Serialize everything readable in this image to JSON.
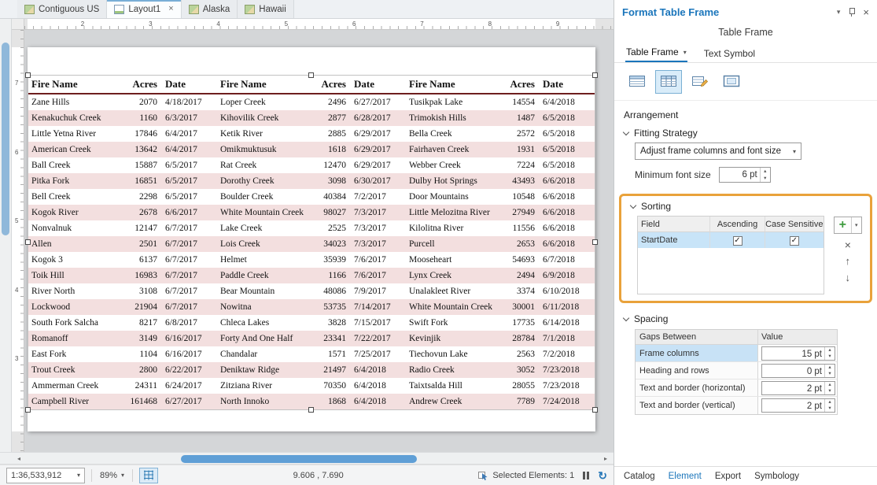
{
  "colors": {
    "accent_blue": "#1a75bb",
    "highlight_orange": "#e9a23b",
    "selection_blue": "#c8e4f8",
    "row_stripe_pink": "#f3dfdf",
    "table_header_line": "#6e1e1e"
  },
  "doc_tabs": [
    {
      "label": "Contiguous US",
      "icon": "map-icon",
      "active": false,
      "closable": false
    },
    {
      "label": "Layout1",
      "icon": "layout-icon",
      "active": true,
      "closable": true
    },
    {
      "label": "Alaska",
      "icon": "map-icon",
      "active": false,
      "closable": false
    },
    {
      "label": "Hawaii",
      "icon": "map-icon",
      "active": false,
      "closable": false
    }
  ],
  "rulers": {
    "horizontal_numbers": [
      "2",
      "3",
      "4",
      "5",
      "6",
      "7",
      "8",
      "9"
    ],
    "vertical_numbers": [
      "7",
      "6",
      "5",
      "4",
      "3"
    ]
  },
  "fire_table": {
    "headers": [
      "Fire Name",
      "Acres",
      "Date"
    ],
    "groups": [
      {
        "rows": [
          [
            "Zane Hills",
            "2070",
            "4/18/2017"
          ],
          [
            "Kenakuchuk Creek",
            "1160",
            "6/3/2017"
          ],
          [
            "Little Yetna River",
            "17846",
            "6/4/2017"
          ],
          [
            "American Creek",
            "13642",
            "6/4/2017"
          ],
          [
            "Ball Creek",
            "15887",
            "6/5/2017"
          ],
          [
            "Pitka Fork",
            "16851",
            "6/5/2017"
          ],
          [
            "Bell Creek",
            "2298",
            "6/5/2017"
          ],
          [
            "Kogok River",
            "2678",
            "6/6/2017"
          ],
          [
            "Nonvalnuk",
            "12147",
            "6/7/2017"
          ],
          [
            "Allen",
            "2501",
            "6/7/2017"
          ],
          [
            "Kogok 3",
            "6137",
            "6/7/2017"
          ],
          [
            "Toik Hill",
            "16983",
            "6/7/2017"
          ],
          [
            "River North",
            "3108",
            "6/7/2017"
          ],
          [
            "Lockwood",
            "21904",
            "6/7/2017"
          ],
          [
            "South Fork Salcha",
            "8217",
            "6/8/2017"
          ],
          [
            "Romanoff",
            "3149",
            "6/16/2017"
          ],
          [
            "East Fork",
            "1104",
            "6/16/2017"
          ],
          [
            "Trout Creek",
            "2800",
            "6/22/2017"
          ],
          [
            "Ammerman Creek",
            "24311",
            "6/24/2017"
          ],
          [
            "Campbell River",
            "161468",
            "6/27/2017"
          ]
        ]
      },
      {
        "rows": [
          [
            "Loper Creek",
            "2496",
            "6/27/2017"
          ],
          [
            "Kihovilik Creek",
            "2877",
            "6/28/2017"
          ],
          [
            "Ketik River",
            "2885",
            "6/29/2017"
          ],
          [
            "Omikmuktusuk",
            "1618",
            "6/29/2017"
          ],
          [
            "Rat Creek",
            "12470",
            "6/29/2017"
          ],
          [
            "Dorothy Creek",
            "3098",
            "6/30/2017"
          ],
          [
            "Boulder Creek",
            "40384",
            "7/2/2017"
          ],
          [
            "White Mountain Creek",
            "98027",
            "7/3/2017"
          ],
          [
            "Lake Creek",
            "2525",
            "7/3/2017"
          ],
          [
            "Lois Creek",
            "34023",
            "7/3/2017"
          ],
          [
            "Helmet",
            "35939",
            "7/6/2017"
          ],
          [
            "Paddle Creek",
            "1166",
            "7/6/2017"
          ],
          [
            "Bear Mountain",
            "48086",
            "7/9/2017"
          ],
          [
            "Nowitna",
            "53735",
            "7/14/2017"
          ],
          [
            "Chleca Lakes",
            "3828",
            "7/15/2017"
          ],
          [
            "Forty And One Half",
            "23341",
            "7/22/2017"
          ],
          [
            "Chandalar",
            "1571",
            "7/25/2017"
          ],
          [
            "Deniktaw Ridge",
            "21497",
            "6/4/2018"
          ],
          [
            "Zitziana River",
            "70350",
            "6/4/2018"
          ],
          [
            "North Innoko",
            "1868",
            "6/4/2018"
          ]
        ]
      },
      {
        "rows": [
          [
            "Tusikpak Lake",
            "14554",
            "6/4/2018"
          ],
          [
            "Trimokish Hills",
            "1487",
            "6/5/2018"
          ],
          [
            "Bella Creek",
            "2572",
            "6/5/2018"
          ],
          [
            "Fairhaven Creek",
            "1931",
            "6/5/2018"
          ],
          [
            "Webber Creek",
            "7224",
            "6/5/2018"
          ],
          [
            "Dulby Hot Springs",
            "43493",
            "6/6/2018"
          ],
          [
            "Door Mountains",
            "10548",
            "6/6/2018"
          ],
          [
            "Little Melozitna River",
            "27949",
            "6/6/2018"
          ],
          [
            "Kilolitna River",
            "11556",
            "6/6/2018"
          ],
          [
            "Purcell",
            "2653",
            "6/6/2018"
          ],
          [
            "Mooseheart",
            "54693",
            "6/7/2018"
          ],
          [
            "Lynx Creek",
            "2494",
            "6/9/2018"
          ],
          [
            "Unalakleet River",
            "3374",
            "6/10/2018"
          ],
          [
            "White Mountain Creek",
            "30001",
            "6/11/2018"
          ],
          [
            "Swift Fork",
            "17735",
            "6/14/2018"
          ],
          [
            "Kevinjik",
            "28784",
            "7/1/2018"
          ],
          [
            "Tiechovun Lake",
            "2563",
            "7/2/2018"
          ],
          [
            "Radio Creek",
            "3052",
            "7/23/2018"
          ],
          [
            "Taixtsalda Hill",
            "28055",
            "7/23/2018"
          ],
          [
            "Andrew Creek",
            "7789",
            "7/24/2018"
          ]
        ]
      }
    ]
  },
  "format_panel": {
    "title": "Format Table Frame",
    "subtitle": "Table Frame",
    "tabs": [
      {
        "label": "Table Frame",
        "active": true
      },
      {
        "label": "Text Symbol",
        "active": false
      }
    ],
    "toolbar_icons": [
      {
        "name": "table-frame-icon",
        "selected": false
      },
      {
        "name": "table-columns-icon",
        "selected": true
      },
      {
        "name": "table-edit-icon",
        "selected": false
      },
      {
        "name": "frame-border-icon",
        "selected": false
      }
    ],
    "arrangement_label": "Arrangement",
    "fitting": {
      "label": "Fitting Strategy",
      "dropdown_value": "Adjust frame columns and font size",
      "min_font_label": "Minimum font size",
      "min_font_value": "6 pt"
    },
    "sorting": {
      "label": "Sorting",
      "columns": [
        "Field",
        "Ascending",
        "Case Sensitive"
      ],
      "rows": [
        {
          "field": "StartDate",
          "ascending": true,
          "case_sensitive": true,
          "selected": true
        }
      ]
    },
    "spacing": {
      "label": "Spacing",
      "columns": [
        "Gaps Between",
        "Value"
      ],
      "rows": [
        {
          "label": "Frame columns",
          "value": "15 pt",
          "selected": true
        },
        {
          "label": "Heading and rows",
          "value": "0 pt",
          "selected": false
        },
        {
          "label": "Text and border (horizontal)",
          "value": "2 pt",
          "selected": false
        },
        {
          "label": "Text and border (vertical)",
          "value": "2 pt",
          "selected": false
        }
      ]
    },
    "bottom_tabs": [
      {
        "label": "Catalog",
        "active": false
      },
      {
        "label": "Element",
        "active": true
      },
      {
        "label": "Export",
        "active": false
      },
      {
        "label": "Symbology",
        "active": false
      }
    ]
  },
  "status_bar": {
    "scale": "1:36,533,912",
    "zoom": "89%",
    "coordinates": "9.606 , 7.690",
    "selected_elements": "Selected Elements: 1"
  }
}
